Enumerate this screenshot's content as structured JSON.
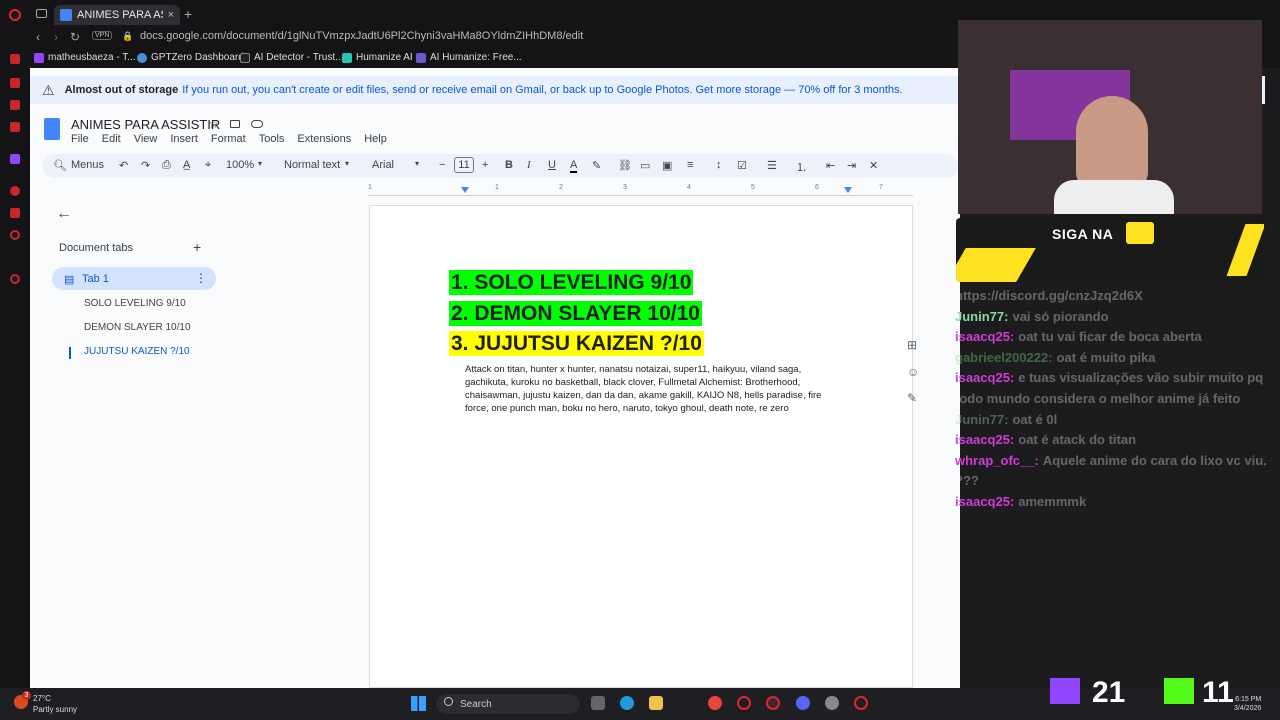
{
  "browser": {
    "tab_title": "ANIMES PARA ASSISTIR -",
    "new_tab": "+",
    "address": "docs.google.com/document/d/1glNuTVmzpxJadtU6Pl2Chyni3vaHMa8OYldmZIHhDM8/edit",
    "vpn": "VPN",
    "bookmarks": [
      "matheusbaeza - T...",
      "GPTZero Dashboard",
      "AI Detector - Trust...",
      "Humanize AI",
      "AI Humanize: Free..."
    ]
  },
  "banner": {
    "title": "Almost out of storage",
    "text": "If you run out, you can't create or edit files, send or receive email on Gmail, or back up to Google Photos. Get more storage — 70% off for 3 months."
  },
  "doc": {
    "title": "ANIMES PARA ASSISTIR",
    "menu": [
      "File",
      "Edit",
      "View",
      "Insert",
      "Format",
      "Tools",
      "Extensions",
      "Help"
    ],
    "toolbar": {
      "menus": "Menus",
      "zoom": "100%",
      "style": "Normal text",
      "font": "Arial",
      "size": "11"
    },
    "ruler": [
      "1",
      "1",
      "2",
      "3",
      "4",
      "5",
      "6",
      "7"
    ],
    "sidebar": {
      "header": "Document tabs",
      "tab": "Tab 1",
      "outline": [
        "SOLO LEVELING 9/10",
        "DEMON SLAYER 10/10",
        "JUJUTSU KAIZEN ?/10"
      ]
    },
    "headings": [
      {
        "text": "1.  SOLO LEVELING 9/10",
        "highlight": "#00ff00"
      },
      {
        "text": "2.  DEMON SLAYER 10/10",
        "highlight": "#00ff00"
      },
      {
        "text": "3.   JUJUTSU KAIZEN ?/10",
        "highlight": "#ffff00"
      }
    ],
    "body": "Attack on titan, hunter x hunter, nanatsu notaizai, super11, haikyuu, viland saga, gachikuta, kuroku no basketball, black clover, Fullmetal Alchemist: Brotherhood, chaisawman, jujustu kaizen, dan da dan, akame gakill, KAIJO N8, hells paradise, fire force, one punch man, boku no hero, naruto, tokyo ghoul, death note, re zero"
  },
  "overlay": {
    "siga": "SIGA NA",
    "chat": [
      {
        "user": "",
        "text": "https://discord.gg/cnzJzq2d6X",
        "color": "#ffffff"
      },
      {
        "user": "Junin77:",
        "text": "vai só piorando",
        "color": "#8fd6a6"
      },
      {
        "user": "isaacq25:",
        "text": "oat tu vai ficar de boca aberta",
        "color": "#cf3cd6"
      },
      {
        "user": "gabrieel200222:",
        "text": "oat é muito pika",
        "color": "#7bd37b"
      },
      {
        "user": "isaacq25:",
        "text": "e tuas visualizações vão subir muito pq todo mundo considera o melhor anime já feito",
        "color": "#cf3cd6"
      },
      {
        "user": "Junin77:",
        "text": "oat é 0l",
        "color": "#8fd6a6"
      },
      {
        "user": "isaacq25:",
        "text": "oat é atack do titan",
        "color": "#cf3cd6"
      },
      {
        "user": "whrap_ofc__:",
        "text": "Aquele anime do cara do lixo vc viu. ???",
        "color": "#cf3cd6"
      },
      {
        "user": "isaacq25:",
        "text": "amemmmk",
        "color": "#cf3cd6"
      }
    ],
    "score_twitch": "21",
    "score_kick": "11"
  },
  "taskbar": {
    "temp": "27°C",
    "weather": "Partly sunny",
    "search": "Search",
    "time": "6:15 PM",
    "date": "3/4/2026",
    "badge": "3"
  }
}
